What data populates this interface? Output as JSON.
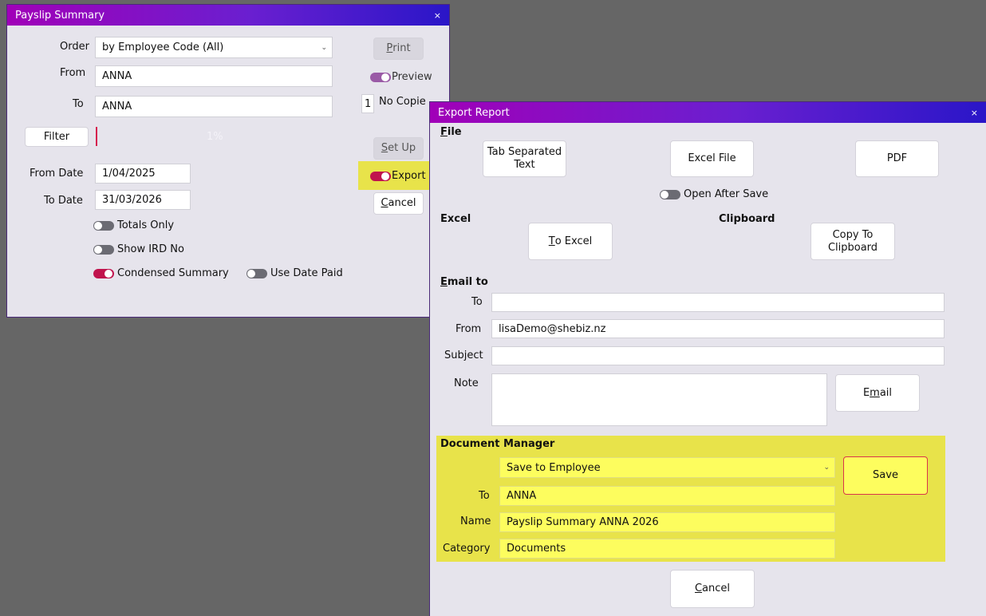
{
  "payslip": {
    "title": "Payslip Summary",
    "close": "×",
    "order_label": "Order",
    "order_value": "by Employee Code (All)",
    "from_label": "From",
    "from_value": "ANNA",
    "to_label": "To",
    "to_value": "ANNA",
    "filter_button": "Filter",
    "progress_text": "1%",
    "from_date_label": "From Date",
    "from_date_value": "1/04/2025",
    "to_date_label": "To Date",
    "to_date_value": "31/03/2026",
    "totals_only": "Totals Only",
    "show_ird": "Show IRD No",
    "condensed_summary": "Condensed Summary",
    "use_date_paid": "Use Date Paid",
    "print_btn": "Print",
    "print_key": "P",
    "print_rest": "rint",
    "preview": "Preview",
    "copies_value": "1",
    "copies_label": "No Copie",
    "setup_key": "S",
    "setup_rest": "et Up",
    "export": "Export",
    "cancel_key": "C",
    "cancel_rest": "ancel"
  },
  "export": {
    "title": "Export Report",
    "close": "×",
    "file_key": "F",
    "file_rest": "ile",
    "tab_separated": "Tab Separated\nText",
    "excel_file": "Excel File",
    "pdf": "PDF",
    "open_after_save": "Open After Save",
    "excel_section": "Excel",
    "clipboard_section": "Clipboard",
    "to_excel_key": "T",
    "to_excel_rest": "o Excel",
    "copy_clipboard": "Copy To\nClipboard",
    "email_to_key": "E",
    "email_to_rest": "mail to",
    "to_label": "To",
    "to_value": "",
    "from_label": "From",
    "from_value": "lisaDemo@shebiz.nz",
    "subject_label": "Subject",
    "subject_value": "",
    "note_label": "Note",
    "note_value": "",
    "email_btn_pre": "E",
    "email_btn_key": "m",
    "email_btn_rest": "ail",
    "doc_manager": "Document Manager",
    "save_to": "Save to Employee",
    "dm_to_label": "To",
    "dm_to_value": "ANNA",
    "dm_name_label": "Name",
    "dm_name_value": "Payslip Summary ANNA 2026",
    "dm_category_label": "Category",
    "dm_category_value": "Documents",
    "save_btn": "Save",
    "cancel_key": "C",
    "cancel_rest": "ancel"
  },
  "colors": {
    "title_gradient_start": "#a100b8",
    "title_gradient_end": "#2a16c8",
    "highlight_yellow": "#e8e34a",
    "toggle_on": "#c0134d",
    "desktop": "#666666"
  }
}
